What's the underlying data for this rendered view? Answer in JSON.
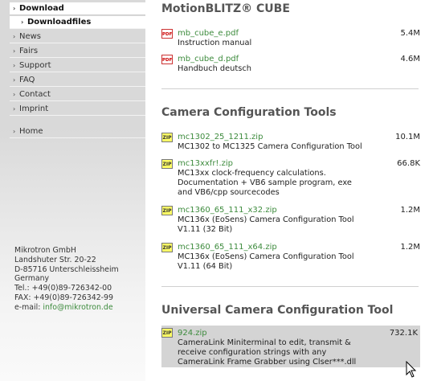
{
  "sidebar": {
    "items": [
      {
        "label": "Download"
      },
      {
        "label": "Downloadfiles"
      },
      {
        "label": "News"
      },
      {
        "label": "Fairs"
      },
      {
        "label": "Support"
      },
      {
        "label": "FAQ"
      },
      {
        "label": "Contact"
      },
      {
        "label": "Imprint"
      },
      {
        "label": "Home"
      }
    ],
    "arrow_glyph": "›"
  },
  "address": {
    "company": "Mikrotron GmbH",
    "street": "Landshuter Str. 20-22",
    "city": "D-85716 Unterschleissheim",
    "country": "Germany",
    "tel": "Tel.: +49(0)89-726342-00",
    "fax": "FAX: +49(0)89-726342-99",
    "email_label": "e-mail: ",
    "email": "info@mikrotron.de"
  },
  "sections": [
    {
      "title": "MotionBLITZ® CUBE",
      "files": [
        {
          "name": "mb_cube_e.pdf",
          "size": "5.4M",
          "desc": "Instruction manual",
          "type": "pdf"
        },
        {
          "name": "mb_cube_d.pdf",
          "size": "4.6M",
          "desc": "Handbuch deutsch",
          "type": "pdf"
        }
      ]
    },
    {
      "title": "Camera Configuration Tools",
      "files": [
        {
          "name": "mc1302_25_1211.zip",
          "size": "10.1M",
          "desc": "MC1302 to MC1325 Camera Configuration Tool",
          "type": "zip"
        },
        {
          "name": "mc13xxfr!.zip",
          "size": "66.8K",
          "desc": "MC13xx clock-frequency calculations.\nDocumentation + VB6 sample program, exe\nand VB6/cpp sourcecodes",
          "type": "zip"
        },
        {
          "name": "mc1360_65_111_x32.zip",
          "size": "1.2M",
          "desc": "MC136x (EoSens) Camera Configuration Tool\nV1.11 (32 Bit)",
          "type": "zip"
        },
        {
          "name": "mc1360_65_111_x64.zip",
          "size": "1.2M",
          "desc": "MC136x (EoSens) Camera Configuration Tool\nV1.11 (64 Bit)",
          "type": "zip"
        }
      ]
    },
    {
      "title": "Universal Camera Configuration Tool",
      "files": [
        {
          "name": "924.zip",
          "size": "732.1K",
          "desc": "CameraLink Miniterminal to edit, transmit &\nreceive configuration strings with any\nCameraLink Frame Grabber using Clser***.dll",
          "type": "zip"
        }
      ]
    }
  ],
  "icons": {
    "pdf_icon_text": "PDF",
    "zip_icon_text": "ZIP"
  }
}
